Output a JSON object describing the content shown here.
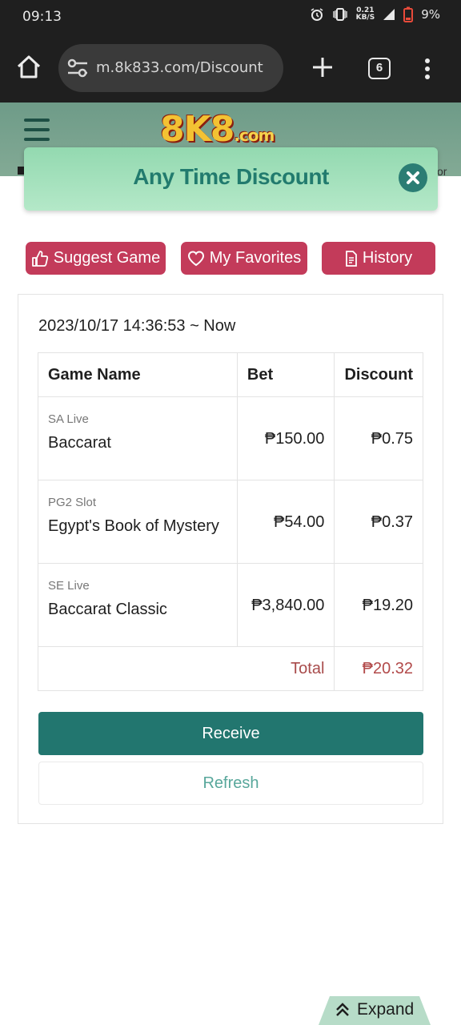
{
  "status_bar": {
    "time": "09:13",
    "network_speed_top": "0.21",
    "network_speed_bottom": "KB/S",
    "battery": "9%"
  },
  "browser": {
    "url": "m.8k833.com/Discount",
    "tab_count": "6"
  },
  "site": {
    "logo_main": "8K8",
    "logo_suffix": ".com",
    "marquee_tail": "or"
  },
  "modal": {
    "title": "Any Time Discount"
  },
  "actions": {
    "suggest_label": "Suggest Game",
    "favorites_label": "My Favorites",
    "history_label": "History"
  },
  "discount": {
    "range": "2023/10/17 14:36:53 ~ Now",
    "headers": {
      "game": "Game Name",
      "bet": "Bet",
      "discount": "Discount"
    },
    "rows": [
      {
        "provider": "SA Live",
        "game": "Baccarat",
        "bet": "₱150.00",
        "discount": "₱0.75"
      },
      {
        "provider": "PG2 Slot",
        "game": "Egypt's Book of Mystery",
        "bet": "₱54.00",
        "discount": "₱0.37"
      },
      {
        "provider": "SE Live",
        "game": "Baccarat Classic",
        "bet": "₱3,840.00",
        "discount": "₱19.20"
      }
    ],
    "total_label": "Total",
    "total_value": "₱20.32",
    "receive_label": "Receive",
    "refresh_label": "Refresh"
  },
  "footer": {
    "expand_label": "Expand"
  },
  "colors": {
    "accent_teal": "#22766f",
    "pill_red": "#c33b5a",
    "total_red": "#b24a4a"
  }
}
